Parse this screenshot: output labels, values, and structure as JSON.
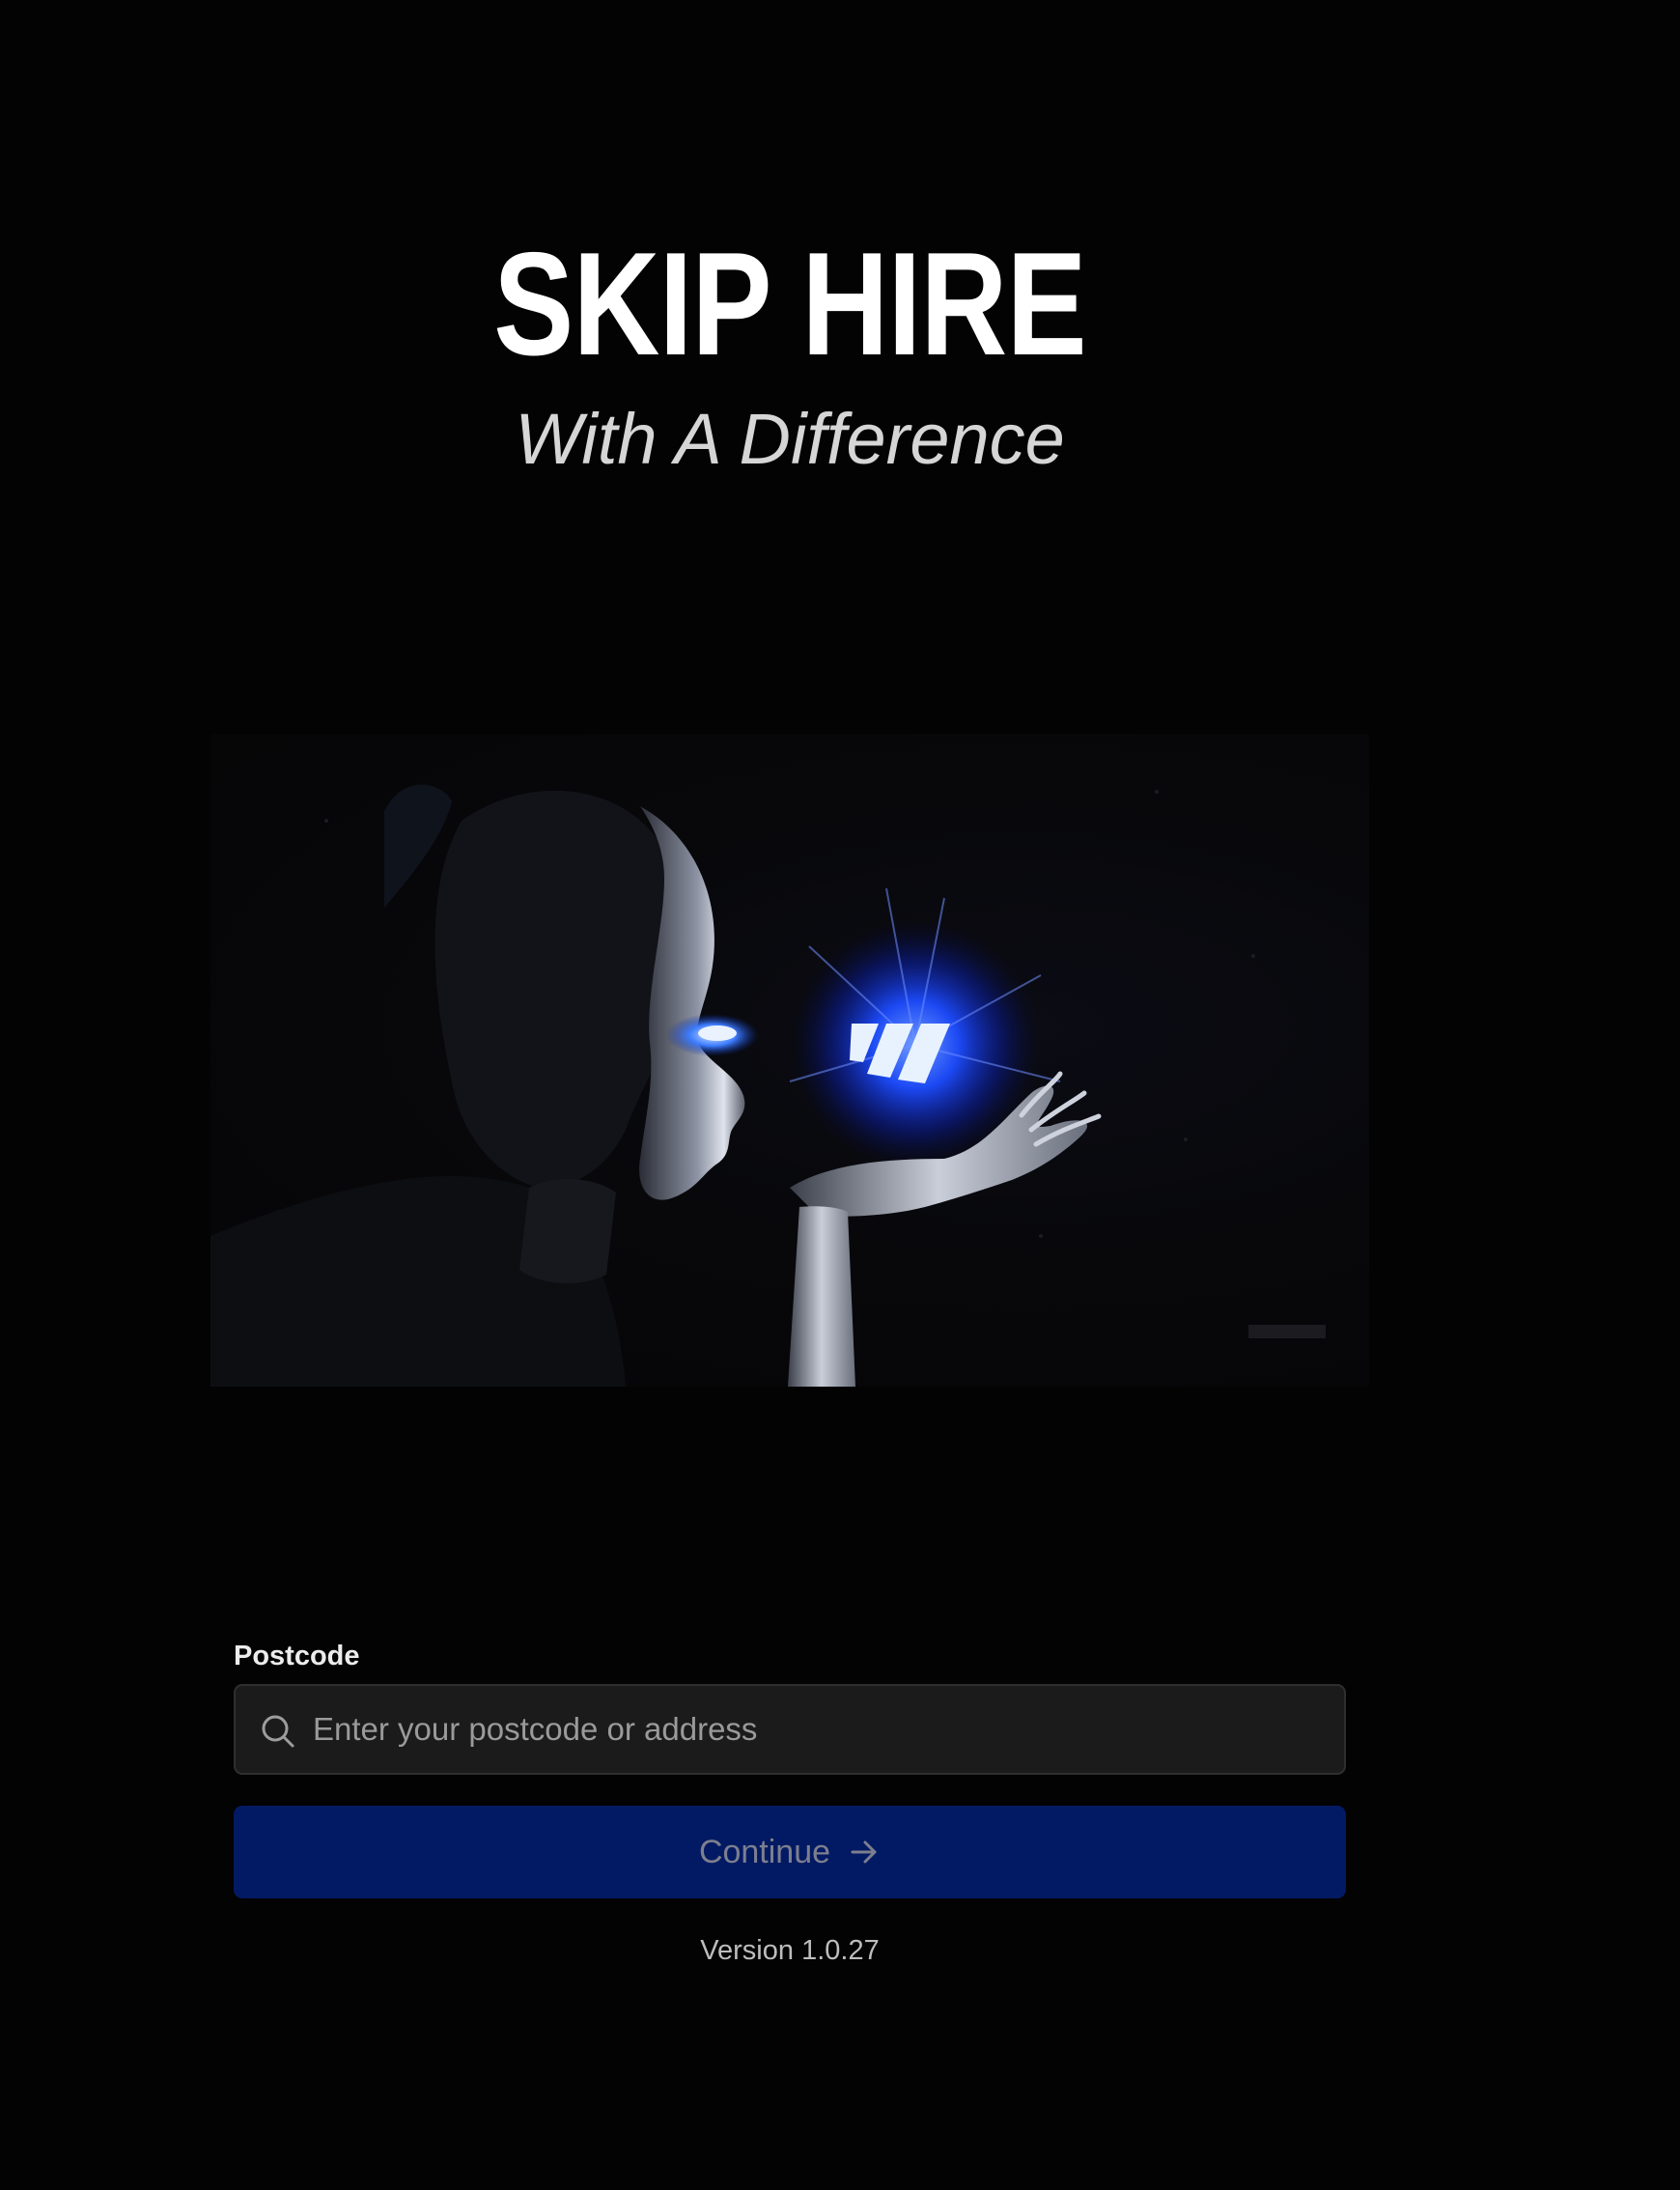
{
  "brand": {
    "title": "SKIP HIRE",
    "subtitle": "With A Difference"
  },
  "hero": {
    "image": "robot-holding-glowing-logo-orb",
    "accent_color": "#1f4dff"
  },
  "form": {
    "postcode_label": "Postcode",
    "search_placeholder": "Enter your postcode or address",
    "search_value": "",
    "continue_label": "Continue",
    "search_icon": "search-icon",
    "continue_icon": "arrow-right-icon"
  },
  "footer": {
    "version": "Version 1.0.27"
  },
  "colors": {
    "background": "#030303",
    "button": "#021a63",
    "input_background": "#1b1b1b"
  }
}
